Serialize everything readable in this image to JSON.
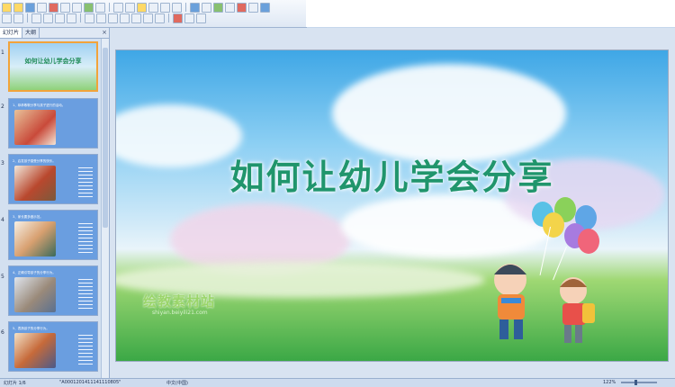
{
  "panel": {
    "tabs": [
      "幻灯片",
      "大纲"
    ],
    "close_glyph": "×"
  },
  "thumbnails": [
    {
      "num": "1",
      "kind": "title",
      "title": "如何让幼儿学会分享"
    },
    {
      "num": "2",
      "kind": "photo",
      "caption": "1、恭恭敬敬分享与孩子进行的活动。"
    },
    {
      "num": "3",
      "kind": "photo",
      "caption": "2、启发孩子感受分享的快乐。"
    },
    {
      "num": "4",
      "kind": "photo",
      "caption": "3、家长要多做示范。"
    },
    {
      "num": "5",
      "kind": "photo",
      "caption": "4、正确引导孩子的分享行为。"
    },
    {
      "num": "6",
      "kind": "photo",
      "caption": "5、表扬孩子的分享行为。"
    }
  ],
  "slide": {
    "title": "如何让幼儿学会分享",
    "watermark": "绘教素材站",
    "watermark_url": "shiyan.beiyili21.com"
  },
  "statusbar": {
    "slide_info": "幻灯片 1/6",
    "theme": "\"A0001201411141110805\"",
    "language": "中文(中国)",
    "zoom": "122%"
  },
  "colors": {
    "accent": "#f2a33a",
    "title": "#20956c"
  }
}
